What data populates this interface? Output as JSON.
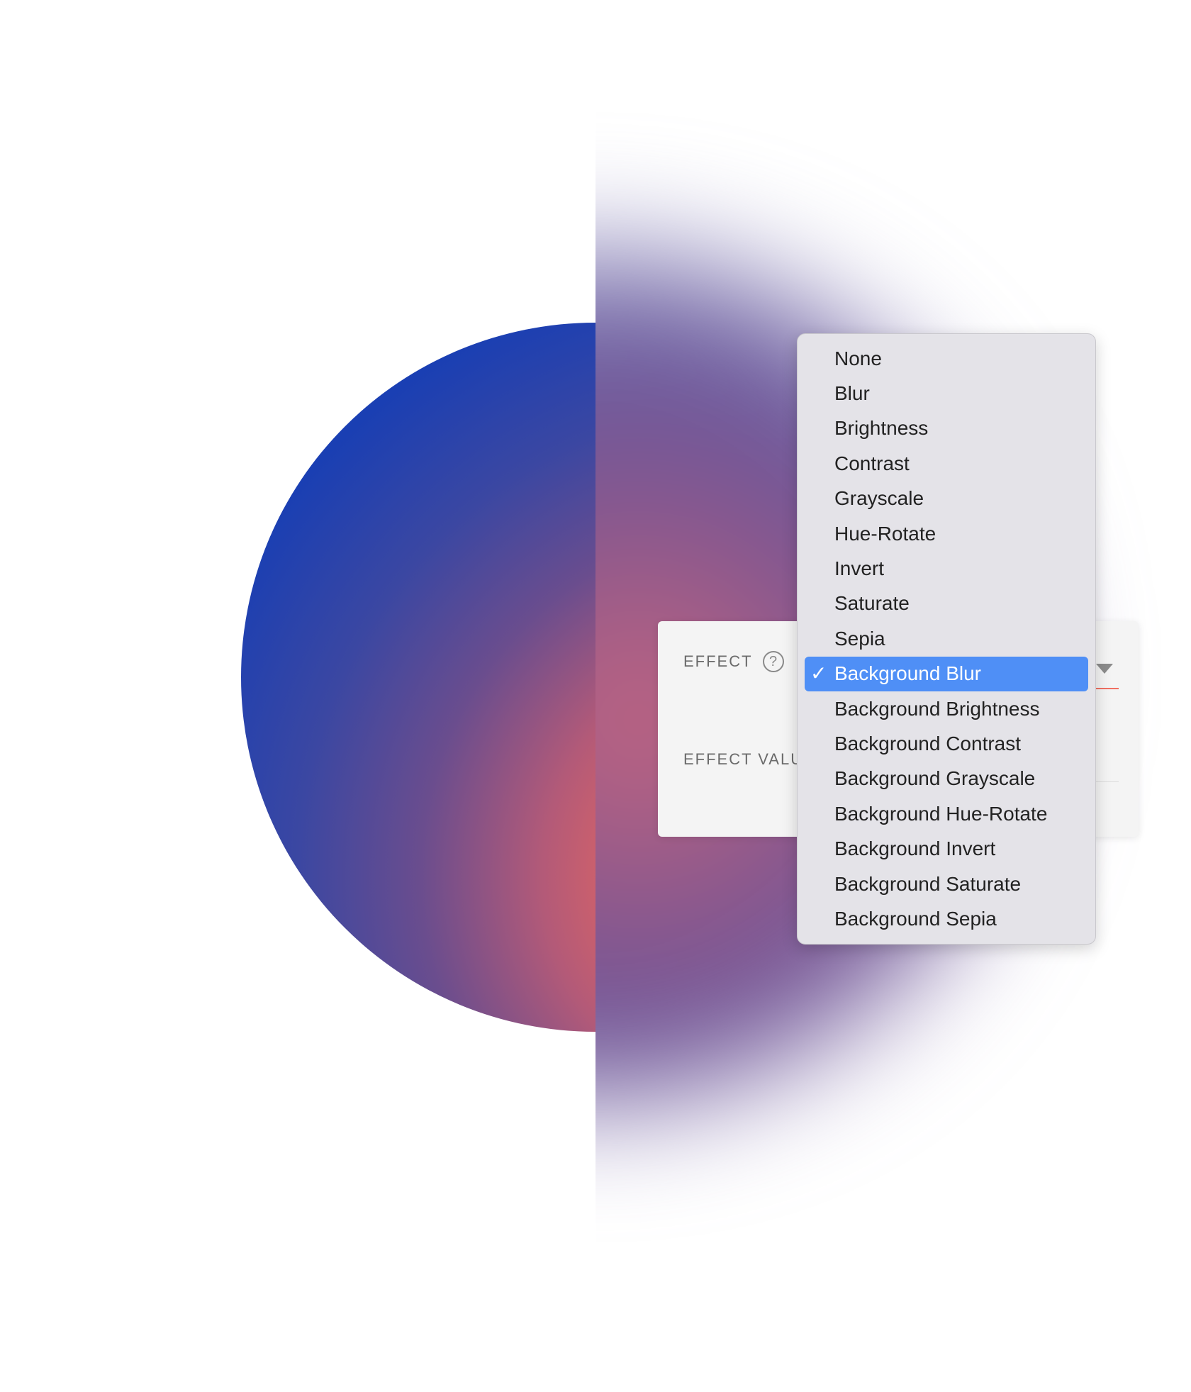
{
  "panel": {
    "effect_label": "EFFECT",
    "help_icon": "question-circle-icon",
    "effect_value_label": "EFFECT VALUE"
  },
  "menu": {
    "items": [
      {
        "label": "None"
      },
      {
        "label": "Blur"
      },
      {
        "label": "Brightness"
      },
      {
        "label": "Contrast"
      },
      {
        "label": "Grayscale"
      },
      {
        "label": "Hue-Rotate"
      },
      {
        "label": "Invert"
      },
      {
        "label": "Saturate"
      },
      {
        "label": "Sepia"
      },
      {
        "label": "Background Blur"
      },
      {
        "label": "Background Brightness"
      },
      {
        "label": "Background Contrast"
      },
      {
        "label": "Background Grayscale"
      },
      {
        "label": "Background Hue-Rotate"
      },
      {
        "label": "Background Invert"
      },
      {
        "label": "Background Saturate"
      },
      {
        "label": "Background Sepia"
      }
    ],
    "selected_index": 9,
    "check_glyph": "✓"
  },
  "colors": {
    "selection": "#4f8ff6",
    "accent_underline": "#f07062",
    "sphere_warm": "#ff6657",
    "sphere_cool": "#1040b4"
  }
}
